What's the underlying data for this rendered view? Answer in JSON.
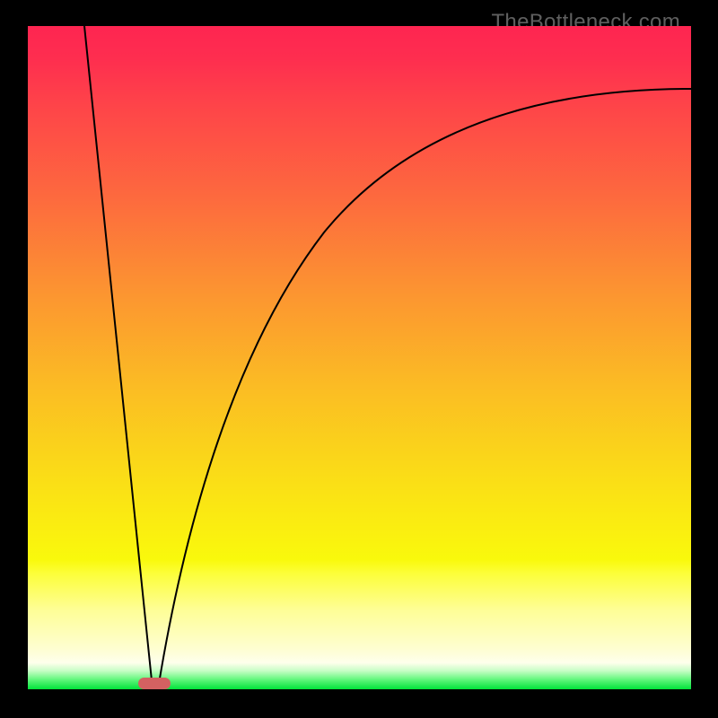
{
  "watermark": "TheBottleneck.com",
  "chart_data": {
    "type": "line",
    "title": "",
    "subtitle": "",
    "xlabel": "",
    "ylabel": "",
    "xlim": [
      0,
      100
    ],
    "ylim": [
      0,
      100
    ],
    "background_gradient_stops": [
      {
        "pct": 0,
        "color": "#fe2551"
      },
      {
        "pct": 12,
        "color": "#fe4449"
      },
      {
        "pct": 26,
        "color": "#fd6a3e"
      },
      {
        "pct": 40,
        "color": "#fc9431"
      },
      {
        "pct": 54,
        "color": "#fbbb24"
      },
      {
        "pct": 68,
        "color": "#fadd17"
      },
      {
        "pct": 80.5,
        "color": "#f9f90c"
      },
      {
        "pct": 88,
        "color": "#fefe96"
      },
      {
        "pct": 96,
        "color": "#feffec"
      },
      {
        "pct": 98.5,
        "color": "#64f77e"
      },
      {
        "pct": 100,
        "color": "#01e33a"
      }
    ],
    "series": [
      {
        "name": "left-descending-line",
        "x": [
          8.5,
          18.8
        ],
        "y": [
          100,
          0
        ]
      },
      {
        "name": "right-rising-curve",
        "x": [
          19.6,
          22,
          25,
          28,
          32,
          36,
          41,
          47,
          54,
          62,
          72,
          84,
          100
        ],
        "y": [
          0,
          14,
          28,
          38,
          48,
          56,
          63,
          70,
          76,
          81,
          85,
          88,
          90.5
        ]
      }
    ],
    "annotations": [
      {
        "name": "vertex-marker",
        "shape": "rounded-rect",
        "x_center": 19.2,
        "y_center": 0.9,
        "width_x_units": 4.9,
        "height_y_units": 1.8,
        "color": "#d36161"
      }
    ]
  }
}
